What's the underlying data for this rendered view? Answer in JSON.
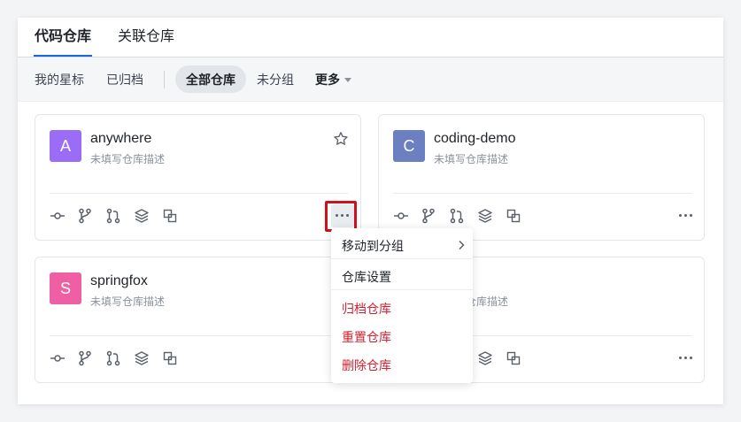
{
  "tabs": [
    {
      "label": "代码仓库",
      "active": true
    },
    {
      "label": "关联仓库",
      "active": false
    }
  ],
  "filters": {
    "starred": "我的星标",
    "archived": "已归档",
    "all": "全部仓库",
    "ungrouped": "未分组",
    "more": "更多"
  },
  "colors": {
    "accent": "#1669d8",
    "danger": "#d2202f",
    "highlight_box": "#d0101a"
  },
  "repos": [
    {
      "letter": "A",
      "name": "anywhere",
      "description": "未填写仓库描述",
      "avatar_color": "#9b6cf5"
    },
    {
      "letter": "C",
      "name": "coding-demo",
      "description": "未填写仓库描述",
      "avatar_color": "#6b7fc1"
    },
    {
      "letter": "S",
      "name": "springfox",
      "description": "未填写仓库描述",
      "avatar_color": "#ef5fa4"
    },
    {
      "description": "未填写仓库描述"
    }
  ],
  "card_actions": [
    "commit-icon",
    "branch-icon",
    "merge-request-icon",
    "layers-icon",
    "copy-icon",
    "more-icon"
  ],
  "context_menu": {
    "move_to_group": "移动到分组",
    "repo_settings": "仓库设置",
    "archive": "归档仓库",
    "reset": "重置仓库",
    "delete": "删除仓库"
  }
}
